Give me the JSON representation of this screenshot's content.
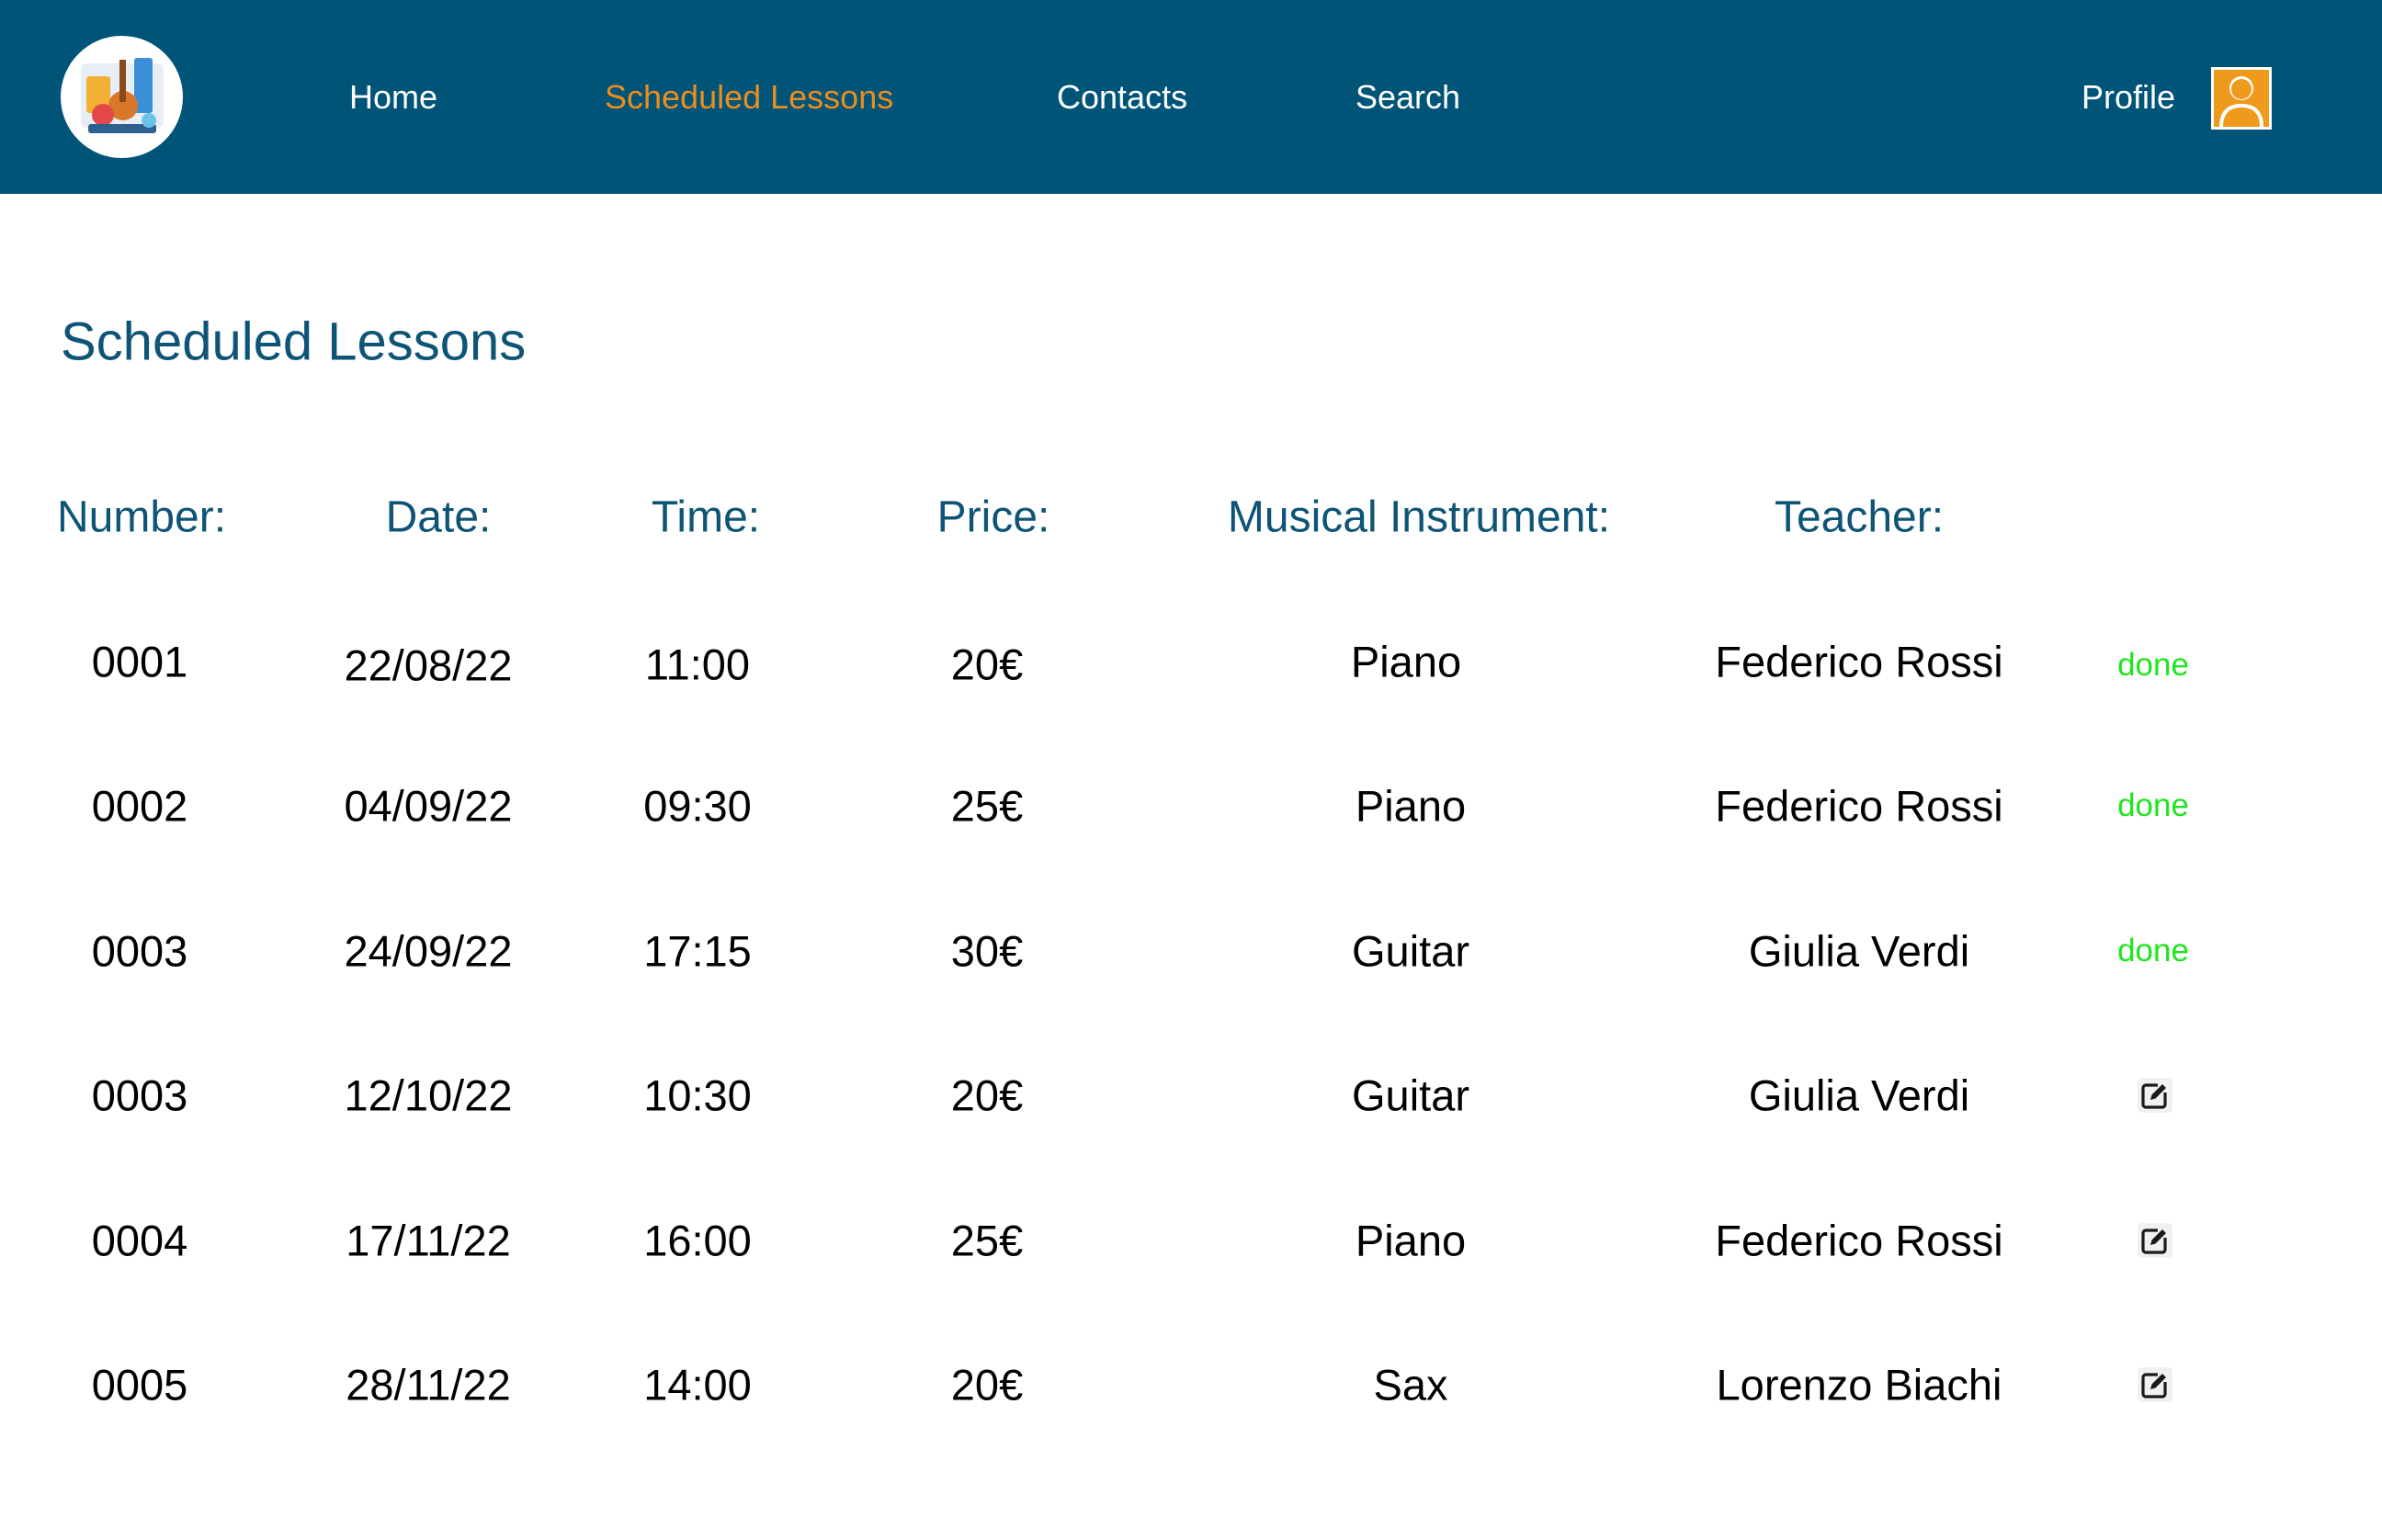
{
  "nav": {
    "links": [
      {
        "label": "Home",
        "active": false
      },
      {
        "label": "Scheduled Lessons",
        "active": true
      },
      {
        "label": "Contacts",
        "active": false
      },
      {
        "label": "Search",
        "active": false
      }
    ],
    "profile_label": "Profile",
    "logo_icon": "music-instruments-logo",
    "avatar_icon": "user-avatar-icon"
  },
  "colors": {
    "navbar_bg": "#005477",
    "active_link": "#ec8d1e",
    "heading": "#0e5477",
    "done": "#1ee61e"
  },
  "page": {
    "title": "Scheduled Lessons"
  },
  "table": {
    "headers": {
      "number": "Number:",
      "date": "Date:",
      "time": "Time:",
      "price": "Price:",
      "instrument": "Musical Instrument:",
      "teacher": "Teacher:"
    },
    "rows": [
      {
        "number": "0001",
        "date": "22/08/22",
        "time": "11:00",
        "price": "20€",
        "instrument": "Piano",
        "teacher": "Federico Rossi",
        "status": "done"
      },
      {
        "number": "0002",
        "date": "04/09/22",
        "time": "09:30",
        "price": "25€",
        "instrument": "Piano",
        "teacher": "Federico Rossi",
        "status": "done"
      },
      {
        "number": "0003",
        "date": "24/09/22",
        "time": "17:15",
        "price": "30€",
        "instrument": "Guitar",
        "teacher": "Giulia Verdi",
        "status": "done"
      },
      {
        "number": "0003",
        "date": "12/10/22",
        "time": "10:30",
        "price": "20€",
        "instrument": "Guitar",
        "teacher": "Giulia Verdi",
        "status_icon": "edit-icon"
      },
      {
        "number": "0004",
        "date": "17/11/22",
        "time": "16:00",
        "price": "25€",
        "instrument": "Piano",
        "teacher": "Federico Rossi",
        "status_icon": "edit-icon"
      },
      {
        "number": "0005",
        "date": "28/11/22",
        "time": "14:00",
        "price": "20€",
        "instrument": "Sax",
        "teacher": "Lorenzo Biachi",
        "status_icon": "edit-icon"
      }
    ]
  }
}
